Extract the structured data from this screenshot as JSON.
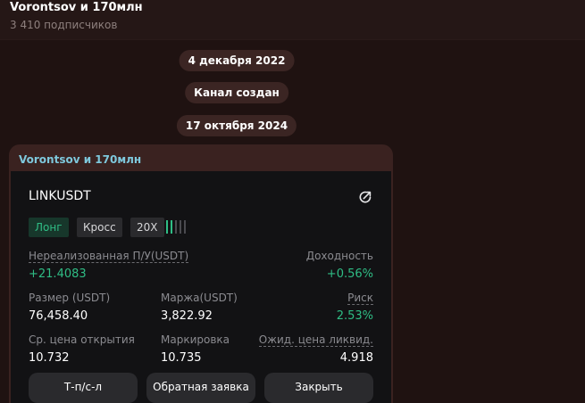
{
  "header": {
    "title": "Vorontsov и 170млн",
    "subscribers": "3 410 подписчиков"
  },
  "service_messages": [
    "4 декабря 2022",
    "Канал создан",
    "17 октября 2024"
  ],
  "message": {
    "sender": "Vorontsov и 170млн",
    "card": {
      "pair": "LINKUSDT",
      "share_icon": "share-icon",
      "tags": {
        "side": "Лонг",
        "margin_mode": "Кросс",
        "leverage": "20X"
      },
      "leverage_level": 0.4,
      "unrealized_label": "Нереализованная П/У(USDT)",
      "unrealized_value": "+21.4083",
      "roi_label": "Доходность",
      "roi_value": "+0.56%",
      "size_label": "Размер (USDT)",
      "size_value": "76,458.40",
      "margin_label": "Маржа(USDT)",
      "margin_value": "3,822.92",
      "risk_label": "Риск",
      "risk_value": "2.53%",
      "entry_label": "Ср. цена открытия",
      "entry_value": "10.732",
      "mark_label": "Маркировка",
      "mark_value": "10.735",
      "liq_label": "Ожид. цена ликвид.",
      "liq_value": "4.918",
      "buttons": {
        "tpsl": "Т-п/с-л",
        "reverse": "Обратная заявка",
        "close": "Закрыть"
      }
    }
  },
  "colors": {
    "background": "#1f1211",
    "bubble": "#3a2220",
    "card": "#121214",
    "positive": "#2fbd85",
    "sender": "#7ec8dc"
  }
}
